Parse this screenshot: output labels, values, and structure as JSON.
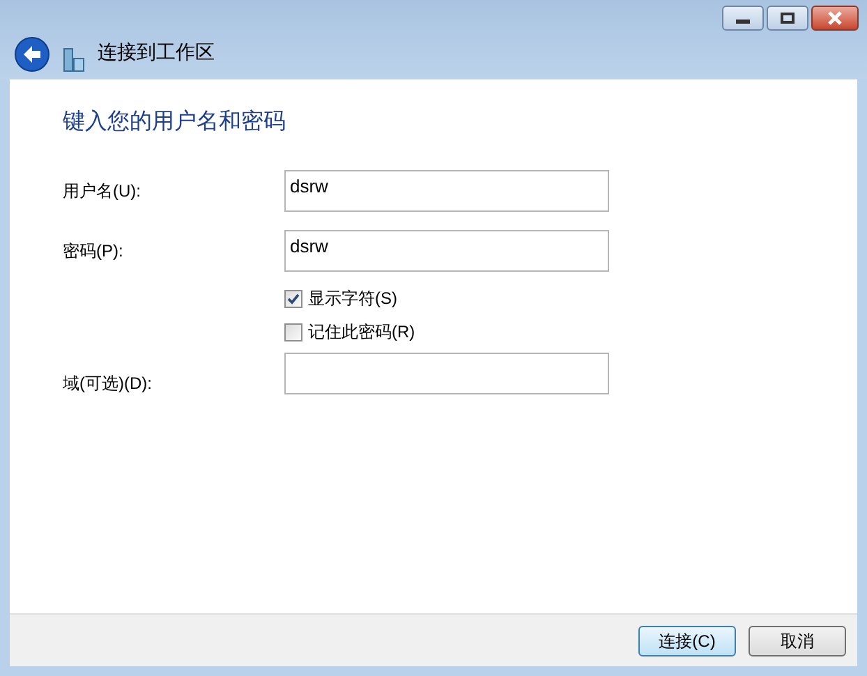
{
  "window": {
    "title": "连接到工作区"
  },
  "heading": "键入您的用户名和密码",
  "fields": [
    {
      "label": "用户名(U):",
      "value": "dsrw"
    },
    {
      "label": "密码(P):",
      "value": "dsrw"
    }
  ],
  "options": [
    {
      "label": "显示字符(S)",
      "checked": true
    },
    {
      "label": "记住此密码(R)",
      "checked": false
    }
  ],
  "domain": {
    "label": "域(可选)(D):"
  },
  "buttons": [
    {
      "label": "连接(C)",
      "default": true
    },
    {
      "label": "取消",
      "default": false
    }
  ]
}
